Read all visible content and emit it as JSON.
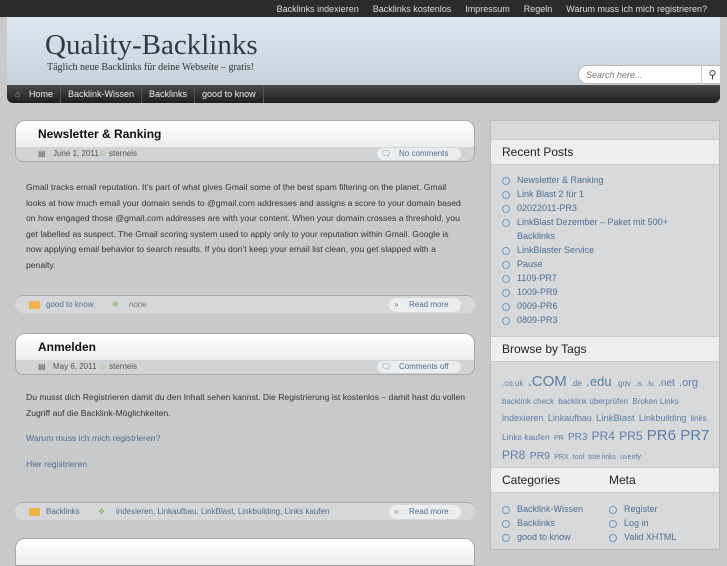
{
  "topnav": [
    "Backlinks indexieren",
    "Backlinks kostenlos",
    "Impressum",
    "Regeln",
    "Warum muss ich mich registrieren?"
  ],
  "header": {
    "title": "Quality-Backlinks",
    "tagline": "Täglich neue Backlinks für deine Webseite – gratis!",
    "search_placeholder": "Search here..."
  },
  "nav": [
    "Home",
    "Backlink-Wissen",
    "Backlinks",
    "good to know"
  ],
  "posts": [
    {
      "title": "Newsletter & Ranking",
      "date": "June 1, 2011",
      "author": "sterneis",
      "comments": "No comments",
      "body": "Gmail tracks email reputation. It’s part of what gives Gmail some of the best spam filtering on the planet. Gmail looks at how much email your domain sends to @gmail.com addresses and assigns a score to your domain based on how engaged those @gmail.com addresses are with your content. When your domain crosses a threshold, you get labelled as suspect. The Gmail scoring system used to apply only to your reputation within Gmail. Google is now applying email behavior to search results. If you don’t keep your email list clean, you get slapped with a penalty.",
      "category": "good to know",
      "tags": "none",
      "read_more": "Read more"
    },
    {
      "title": "Anmelden",
      "date": "May 6, 2011",
      "author": "sterneis",
      "comments": "Comments off",
      "body": "Du musst dich Registrieren damit du den Inhalt sehen kannst. Die Registrierung ist kostenlos – damit hast du vollen Zugriff auf die Backlink-Möglichkeiten.",
      "link1": "Warum muss ich mich registrieren?",
      "link2": "Hier registrieren",
      "category": "Backlinks",
      "tags": "indexieren, Linkaufbau, LinkBlast, Linkbuilding, Links kaufen",
      "read_more": "Read more"
    }
  ],
  "sidebar": {
    "recent_title": "Recent Posts",
    "recent": [
      "Newsletter & Ranking",
      "Link Blast 2 für 1",
      "02022011-PR3",
      "LinkBlast Dezember – Paket mit 500+ Backlinks",
      "LinkBlaster Service",
      "Pause",
      "1109-PR7",
      "1009-PR9",
      "0909-PR6",
      "0809-PR3"
    ],
    "tags_title": "Browse by Tags",
    "tags": [
      {
        "t": ".co.uk",
        "s": 8
      },
      {
        "t": ".COM",
        "s": 15
      },
      {
        "t": ".de",
        "s": 8
      },
      {
        "t": ".edu",
        "s": 13
      },
      {
        "t": ".gov",
        "s": 8
      },
      {
        "t": ".is",
        "s": 7
      },
      {
        "t": ".lu",
        "s": 7
      },
      {
        "t": ".net",
        "s": 10
      },
      {
        "t": ".org",
        "s": 11
      },
      {
        "t": "backlink check",
        "s": 8
      },
      {
        "t": "backlink überprüfen",
        "s": 8
      },
      {
        "t": "Broken Links",
        "s": 8
      },
      {
        "t": "indexieren",
        "s": 9
      },
      {
        "t": "Linkaufbau",
        "s": 9
      },
      {
        "t": "LinkBlast",
        "s": 9.5
      },
      {
        "t": "Linkbuilding",
        "s": 9
      },
      {
        "t": "links",
        "s": 8
      },
      {
        "t": "Links kaufen",
        "s": 8.5
      },
      {
        "t": "PR",
        "s": 7
      },
      {
        "t": "PR3",
        "s": 10
      },
      {
        "t": "PR4",
        "s": 12
      },
      {
        "t": "PR5",
        "s": 12
      },
      {
        "t": "PR6",
        "s": 15
      },
      {
        "t": "PR7",
        "s": 15
      },
      {
        "t": "PR8",
        "s": 12
      },
      {
        "t": "PR9",
        "s": 10.5
      },
      {
        "t": "PRX",
        "s": 7
      },
      {
        "t": "tool",
        "s": 7
      },
      {
        "t": "tote links",
        "s": 7
      },
      {
        "t": "uverify",
        "s": 7
      }
    ],
    "categories_title": "Categories",
    "categories": [
      "Backlink-Wissen",
      "Backlinks",
      "good to know"
    ],
    "meta_title": "Meta",
    "meta": [
      "Register",
      "Log in",
      "Valid XHTML"
    ]
  }
}
